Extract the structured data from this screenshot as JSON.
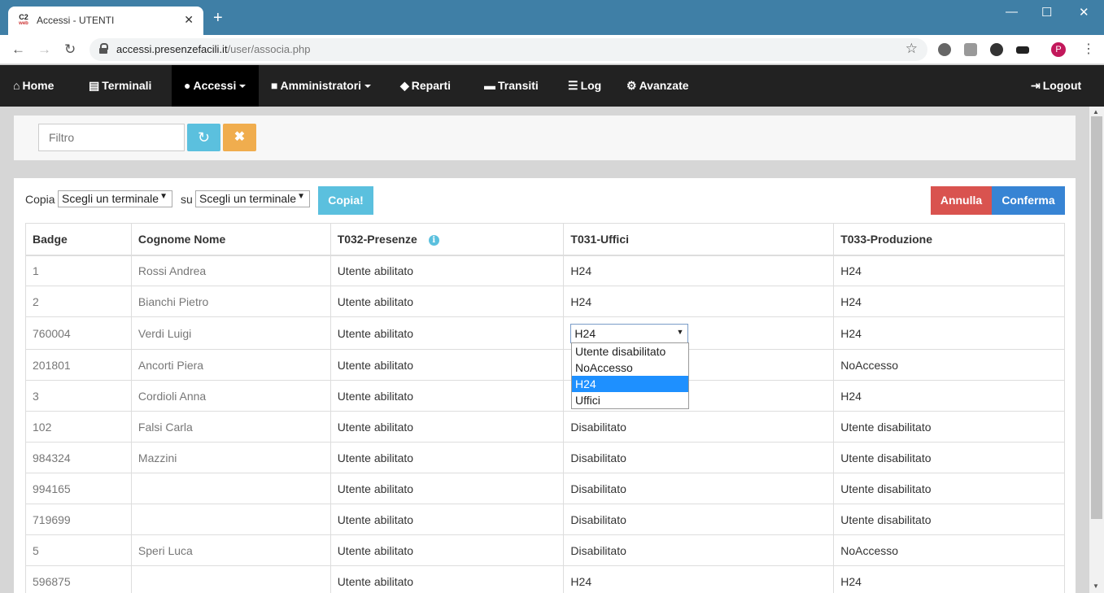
{
  "browser": {
    "tab_title": "Accessi - UTENTI",
    "favicon_text": "C2",
    "favicon_sub": "web",
    "url_host": "accessi.presenzefacili.it",
    "url_path": "/user/associa.php",
    "profile_initial": "P"
  },
  "nav": {
    "items": [
      {
        "label": "Home",
        "icon": "home-icon"
      },
      {
        "label": "Terminali",
        "icon": "hdd-icon"
      },
      {
        "label": "Accessi",
        "icon": "user-icon"
      },
      {
        "label": "Amministratori",
        "icon": "lock-icon"
      },
      {
        "label": "Reparti",
        "icon": "tags-icon"
      },
      {
        "label": "Transiti",
        "icon": "credit-card-icon"
      },
      {
        "label": "Log",
        "icon": "tasks-icon"
      },
      {
        "label": "Avanzate",
        "icon": "cog-icon"
      }
    ],
    "logout": "Logout"
  },
  "filter": {
    "placeholder": "Filtro"
  },
  "copy": {
    "label": "Copia",
    "su": "su",
    "from_select": "Scegli un terminale",
    "to_select": "Scegli un terminale",
    "button": "Copia!"
  },
  "actions": {
    "annulla": "Annulla",
    "conferma": "Conferma"
  },
  "table": {
    "headers": [
      "Badge",
      "Cognome Nome",
      "T032-Presenze",
      "T031-Uffici",
      "T033-Produzione"
    ],
    "rows": [
      [
        "1",
        "Rossi Andrea",
        "Utente abilitato",
        "H24",
        "H24"
      ],
      [
        "2",
        "Bianchi Pietro",
        "Utente abilitato",
        "H24",
        "H24"
      ],
      [
        "760004",
        "Verdi Luigi",
        "Utente abilitato",
        "H24",
        "H24"
      ],
      [
        "201801",
        "Ancorti Piera",
        "Utente abilitato",
        "",
        "NoAccesso"
      ],
      [
        "3",
        "Cordioli Anna",
        "Utente abilitato",
        "",
        "H24"
      ],
      [
        "102",
        "Falsi Carla",
        "Utente abilitato",
        "Disabilitato",
        "Utente disabilitato"
      ],
      [
        "984324",
        "Mazzini",
        "Utente abilitato",
        "Disabilitato",
        "Utente disabilitato"
      ],
      [
        "994165",
        "",
        "Utente abilitato",
        "Disabilitato",
        "Utente disabilitato"
      ],
      [
        "719699",
        "",
        "Utente abilitato",
        "Disabilitato",
        "Utente disabilitato"
      ],
      [
        "5",
        "Speri Luca",
        "Utente abilitato",
        "Disabilitato",
        "NoAccesso"
      ],
      [
        "596875",
        "",
        "Utente abilitato",
        "H24",
        "H24"
      ]
    ]
  },
  "dropdown": {
    "current": "H24",
    "options": [
      "Utente disabilitato",
      "NoAccesso",
      "H24",
      "Uffici"
    ],
    "selected_index": 2
  }
}
